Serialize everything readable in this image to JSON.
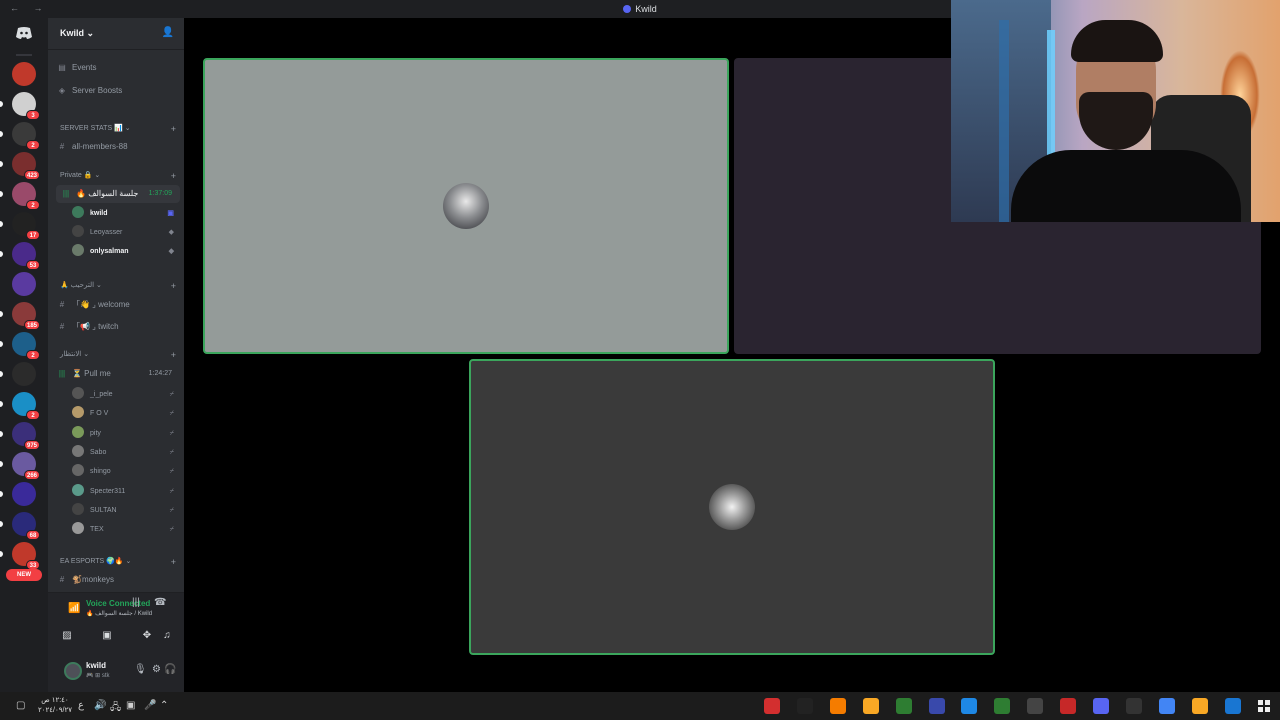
{
  "window": {
    "title": "Kwild",
    "nav": "← →"
  },
  "rail": {
    "home_icon": "discord-icon",
    "new_label": "NEW",
    "servers": [
      {
        "color": "#c0392b",
        "badge": ""
      },
      {
        "color": "#d0d0d0",
        "badge": "3"
      },
      {
        "color": "#3a3a3a",
        "badge": "2"
      },
      {
        "color": "#7a2e2e",
        "badge": "423"
      },
      {
        "color": "#9a4a6a",
        "badge": "2"
      },
      {
        "color": "#222",
        "badge": "17"
      },
      {
        "color": "#4a2a8a",
        "badge": "53"
      },
      {
        "color": "#5a3aa0",
        "badge": ""
      },
      {
        "color": "#8a3a3a",
        "badge": "185"
      },
      {
        "color": "#1d5f8a",
        "badge": "2"
      },
      {
        "color": "#2b2b2b",
        "badge": ""
      },
      {
        "color": "#1a8fc6",
        "badge": "2"
      },
      {
        "color": "#3b2f7a",
        "badge": "975"
      },
      {
        "color": "#6a5aa0",
        "badge": "266"
      },
      {
        "color": "#3a2a9a",
        "badge": ""
      },
      {
        "color": "#2a2a7a",
        "badge": "68"
      },
      {
        "color": "#c0392b",
        "badge": "33"
      }
    ]
  },
  "sidebar": {
    "server_name": "Kwild",
    "events": "Events",
    "boosts": "Server Boosts",
    "cat_stats": "SERVER STATS 📊",
    "all_members": "all-members-88",
    "cat_private": "Private 🔒",
    "voice1": {
      "name": "🔥 جلسة السوالف",
      "time": "1:37:09"
    },
    "voice1_users": [
      "kwild",
      "Leoyasser",
      "onlysalman"
    ],
    "cat_welcome": "الترحيب",
    "welcome": "「👋 ⌟ welcome",
    "twitch": "「📢 ⌟ twitch",
    "cat_wait": "الانتظار",
    "voice2": {
      "name": "⏳ Pull me",
      "time": "1:24:27"
    },
    "voice2_users": [
      "_i_pele",
      "F O V",
      "pity",
      "Sabo",
      "shingo",
      "Specter311",
      "SULTAN",
      "TEX"
    ],
    "cat_ea": "EA ESPORTS 🌍🔥",
    "monkeys": "🐒monkeys"
  },
  "voice_connection": {
    "status": "Voice Connected",
    "channel": "🔥 جلسة السوالف / Kwild"
  },
  "user_panel": {
    "name": "kwild",
    "status": "🎮 ⊞ stk"
  },
  "taskbar": {
    "time": "١٢:٤٠ ص",
    "date": "٢٠٢٤/٠٩/٢٧",
    "lang": "ع"
  }
}
